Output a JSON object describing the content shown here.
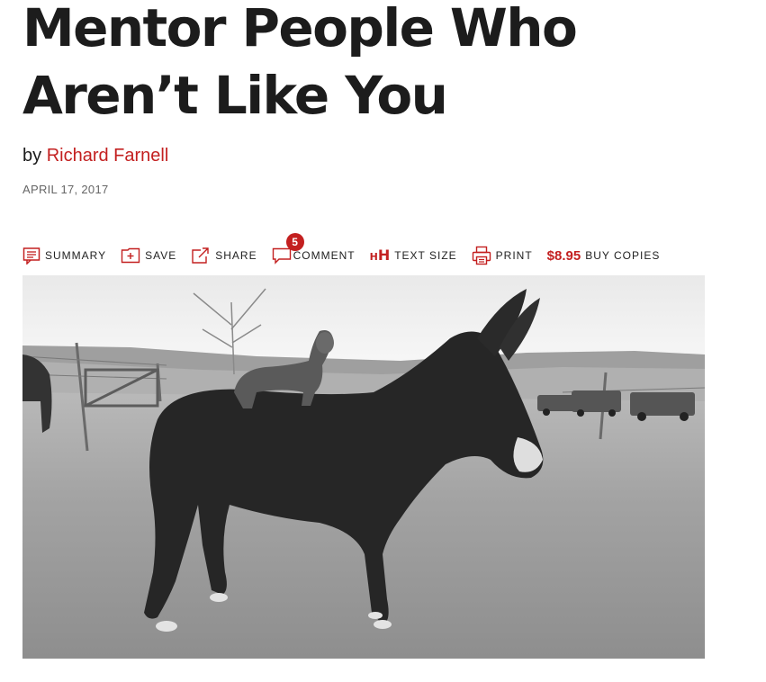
{
  "article": {
    "title": "Mentor People Who Aren’t Like You",
    "byline_prefix": "by",
    "author": "Richard Farnell",
    "date": "APRIL 17, 2017"
  },
  "toolbar": {
    "summary_label": "SUMMARY",
    "save_label": "SAVE",
    "share_label": "SHARE",
    "comment_label": "COMMENT",
    "comment_count": "5",
    "text_size_label": "TEXT SIZE",
    "print_label": "PRINT",
    "price": "$8.95",
    "buy_label": "BUY COPIES"
  },
  "colors": {
    "accent": "#c32020",
    "text": "#1a1a1a",
    "muted": "#666666"
  },
  "icons": [
    "summary-icon",
    "save-icon",
    "share-icon",
    "comment-icon",
    "text-size-icon",
    "print-icon"
  ]
}
